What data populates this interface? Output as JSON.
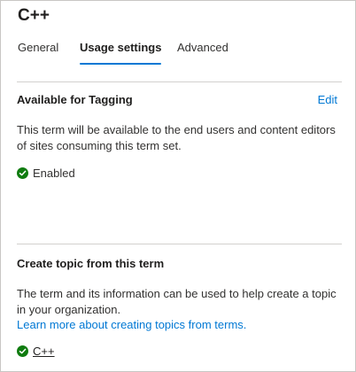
{
  "title": "C++",
  "tabs": [
    {
      "label": "General"
    },
    {
      "label": "Usage settings"
    },
    {
      "label": "Advanced"
    }
  ],
  "tagging": {
    "title": "Available for Tagging",
    "edit_label": "Edit",
    "description": "This term will be available to the end users and content editors of sites consuming this term set.",
    "status": "Enabled"
  },
  "topic": {
    "title": "Create topic from this term",
    "description": "The term and its information can be used to help create a topic in your organization.",
    "learn_more": "Learn more about creating topics from terms.",
    "term_link": "C++"
  },
  "colors": {
    "accent": "#0078d4",
    "success": "#107c10",
    "divider": "#d2d0ce"
  }
}
